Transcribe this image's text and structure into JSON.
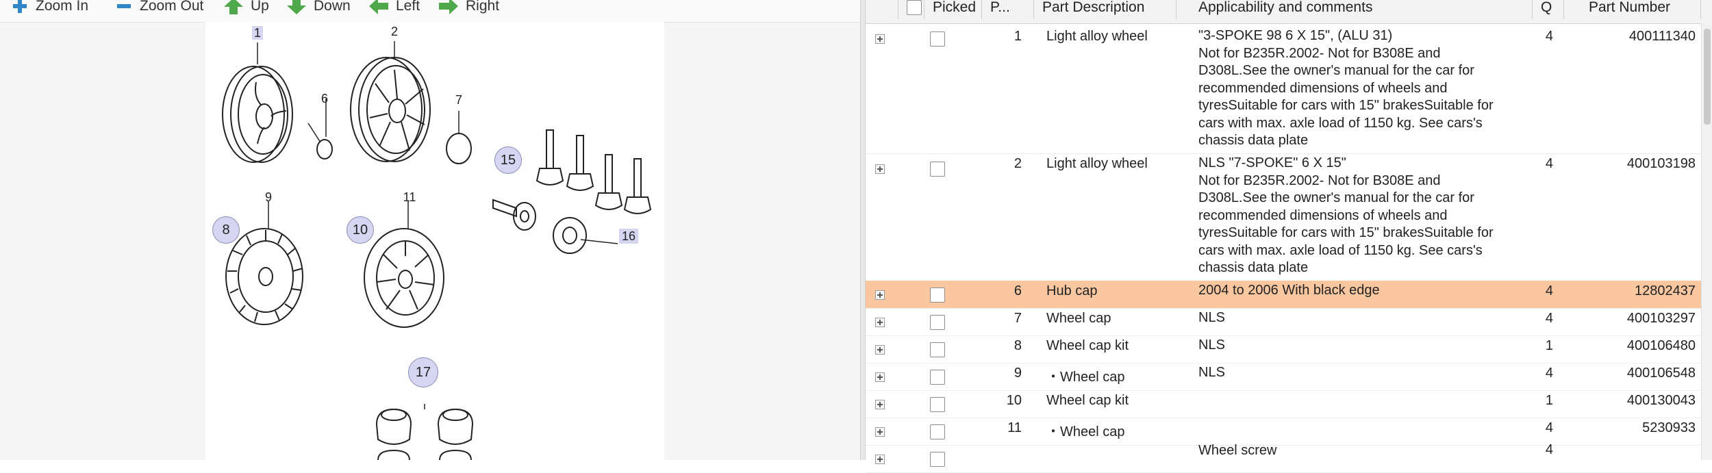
{
  "toolbar": {
    "zoom_in": "Zoom In",
    "zoom_out": "Zoom Out",
    "up": "Up",
    "down": "Down",
    "left": "Left",
    "right": "Right"
  },
  "diagram": {
    "callouts": [
      "1",
      "2",
      "6",
      "7",
      "8",
      "9",
      "10",
      "11",
      "15",
      "16",
      "17"
    ]
  },
  "grid": {
    "headers": {
      "picked": "Picked",
      "position": "P...",
      "description": "Part Description",
      "comments": "Applicability and comments",
      "qty": "Q",
      "part_number": "Part Number"
    },
    "rows": [
      {
        "pos": "1",
        "desc": "Light alloy wheel",
        "comments": "\"3-SPOKE 98 6 X 15\", (ALU 31)\nNot for B235R.2002- Not for B308E and D308L.See the owner's manual for the car for recommended dimensions of wheels and tyresSuitable for cars with 15\" brakesSuitable for cars with max. axle load of 1150 kg. See cars's chassis data plate",
        "qty": "4",
        "part_number": "400111340"
      },
      {
        "pos": "2",
        "desc": "Light alloy wheel",
        "comments": "NLS \"7-SPOKE\" 6 X 15\"\nNot for B235R.2002- Not for B308E and D308L.See the owner's manual for the car for recommended dimensions of wheels and tyresSuitable for cars with 15\" brakesSuitable for cars with max. axle load of 1150 kg. See cars's chassis data plate",
        "qty": "4",
        "part_number": "400103198"
      },
      {
        "pos": "6",
        "desc": "Hub cap",
        "comments": "2004 to 2006 With black edge",
        "qty": "4",
        "part_number": "12802437",
        "highlight": true
      },
      {
        "pos": "7",
        "desc": "Wheel cap",
        "comments": "NLS",
        "qty": "4",
        "part_number": "400103297"
      },
      {
        "pos": "8",
        "desc": "Wheel cap kit",
        "comments": "NLS",
        "qty": "1",
        "part_number": "400106480"
      },
      {
        "pos": "9",
        "desc": "・Wheel cap",
        "comments": "NLS",
        "qty": "4",
        "part_number": "400106548"
      },
      {
        "pos": "10",
        "desc": "Wheel cap kit",
        "comments": "",
        "qty": "1",
        "part_number": "400130043"
      },
      {
        "pos": "11",
        "desc": "・Wheel cap",
        "comments": "",
        "qty": "4",
        "part_number": "5230933"
      },
      {
        "pos": "",
        "desc": "",
        "comments": "Wheel screw",
        "qty": "4",
        "part_number": ""
      }
    ]
  },
  "colors": {
    "highlight_row": "#fbc7a0",
    "toolbar_icon": "#2f87c8",
    "arrow_icon": "#4fa84a",
    "callout_fill": "#d6d6f3"
  }
}
